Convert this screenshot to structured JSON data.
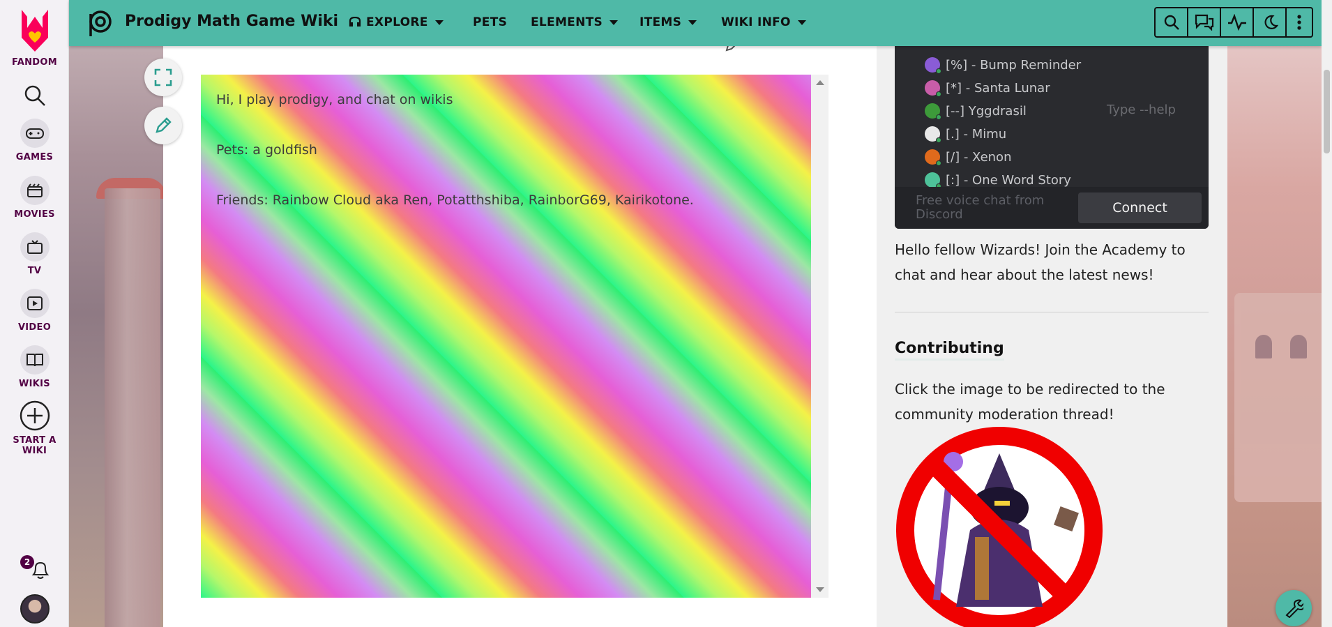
{
  "fandom_sidebar": {
    "brand_label": "FANDOM",
    "items": [
      {
        "label": "GAMES"
      },
      {
        "label": "MOVIES"
      },
      {
        "label": "TV"
      },
      {
        "label": "VIDEO"
      },
      {
        "label": "WIKIS"
      },
      {
        "label": "START A WIKI"
      }
    ],
    "notification_count": "2"
  },
  "topnav": {
    "wiki_title": "Prodigy Math Game Wiki",
    "links": [
      {
        "label": "EXPLORE"
      },
      {
        "label": "PETS"
      },
      {
        "label": "ELEMENTS"
      },
      {
        "label": "ITEMS"
      },
      {
        "label": "WIKI INFO"
      }
    ]
  },
  "article": {
    "intro": "Hi, I play prodigy, and chat on wikis",
    "pets": "Pets: a goldfish",
    "friends": "Friends: Rainbow Cloud aka Ren, Potatthshiba, RainborG69, Kairikotone."
  },
  "discord": {
    "members": [
      {
        "name": "[%] - Bump Reminder"
      },
      {
        "name": "[*] - Santa Lunar"
      },
      {
        "name": "[--] Yggdrasil"
      },
      {
        "name": "[.] - Mimu"
      },
      {
        "name": "[/] - Xenon"
      },
      {
        "name": "[:] - One Word Story"
      }
    ],
    "hint": "Type --help",
    "free_voice": "Free voice chat from Discord",
    "connect_label": "Connect"
  },
  "rail": {
    "welcome": "Hello fellow Wizards! Join the Academy to chat and hear about the latest news!",
    "contributing_heading": "Contributing",
    "contributing_text": "Click the image to be redirected to the community moderation thread!"
  },
  "colors": {
    "nav_bg": "#4fb9a7",
    "fandom_brand": "#520044",
    "discord_bg": "#2a2b2f"
  }
}
